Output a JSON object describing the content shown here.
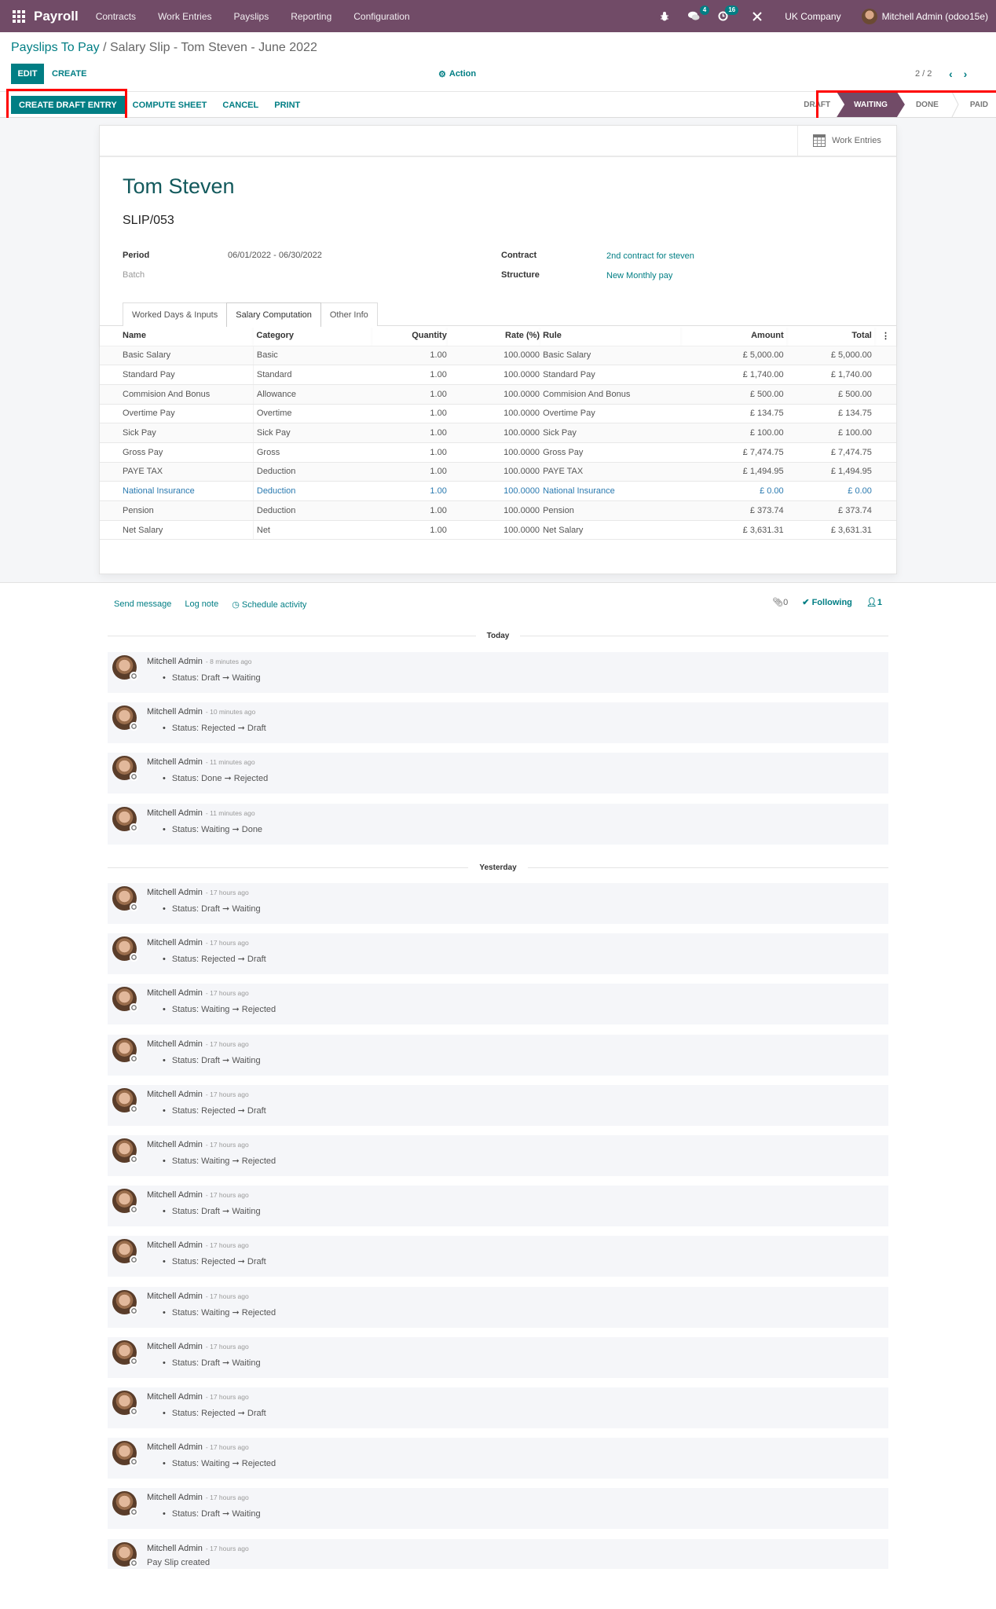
{
  "navbar": {
    "app_name": "Payroll",
    "menus": [
      "Contracts",
      "Work Entries",
      "Payslips",
      "Reporting",
      "Configuration"
    ],
    "messages_badge": "4",
    "activities_badge": "16",
    "company": "UK Company",
    "user": "Mitchell Admin (odoo15e)"
  },
  "breadcrumb": {
    "parent": "Payslips To Pay",
    "separator": " / ",
    "current": "Salary Slip - Tom Steven - June 2022"
  },
  "control": {
    "edit_label": "EDIT",
    "create_label": "CREATE",
    "action_label": "Action",
    "pager": "2 / 2"
  },
  "statusbar": {
    "buttons": {
      "create_draft_entry": "CREATE DRAFT ENTRY",
      "compute_sheet": "COMPUTE SHEET",
      "cancel": "CANCEL",
      "print": "PRINT"
    },
    "stages": [
      "DRAFT",
      "WAITING",
      "DONE",
      "PAID"
    ],
    "active_stage": "WAITING"
  },
  "sheet": {
    "smart_button": "Work Entries",
    "employee": "Tom Steven",
    "reference": "SLIP/053",
    "fields": {
      "period_label": "Period",
      "period_value": "06/01/2022 - 06/30/2022",
      "batch_label": "Batch",
      "contract_label": "Contract",
      "contract_value": "2nd contract for steven",
      "structure_label": "Structure",
      "structure_value": "New Monthly pay"
    },
    "tabs": [
      "Worked Days & Inputs",
      "Salary Computation",
      "Other Info"
    ],
    "active_tab": "Salary Computation",
    "table": {
      "headers": [
        "Name",
        "Category",
        "Quantity",
        "Rate (%)",
        "Rule",
        "Amount",
        "Total"
      ],
      "rows": [
        {
          "name": "Basic Salary",
          "category": "Basic",
          "quantity": "1.00",
          "rate": "100.0000",
          "rule": "Basic Salary",
          "amount": "£ 5,000.00",
          "total": "£ 5,000.00"
        },
        {
          "name": "Standard Pay",
          "category": "Standard",
          "quantity": "1.00",
          "rate": "100.0000",
          "rule": "Standard Pay",
          "amount": "£ 1,740.00",
          "total": "£ 1,740.00"
        },
        {
          "name": "Commision And Bonus",
          "category": "Allowance",
          "quantity": "1.00",
          "rate": "100.0000",
          "rule": "Commision And Bonus",
          "amount": "£ 500.00",
          "total": "£ 500.00"
        },
        {
          "name": "Overtime Pay",
          "category": "Overtime",
          "quantity": "1.00",
          "rate": "100.0000",
          "rule": "Overtime Pay",
          "amount": "£ 134.75",
          "total": "£ 134.75"
        },
        {
          "name": "Sick Pay",
          "category": "Sick Pay",
          "quantity": "1.00",
          "rate": "100.0000",
          "rule": "Sick Pay",
          "amount": "£ 100.00",
          "total": "£ 100.00"
        },
        {
          "name": "Gross Pay",
          "category": "Gross",
          "quantity": "1.00",
          "rate": "100.0000",
          "rule": "Gross Pay",
          "amount": "£ 7,474.75",
          "total": "£ 7,474.75"
        },
        {
          "name": "PAYE TAX",
          "category": "Deduction",
          "quantity": "1.00",
          "rate": "100.0000",
          "rule": "PAYE TAX",
          "amount": "£ 1,494.95",
          "total": "£ 1,494.95"
        },
        {
          "name": "National Insurance",
          "category": "Deduction",
          "quantity": "1.00",
          "rate": "100.0000",
          "rule": "National Insurance",
          "amount": "£ 0.00",
          "total": "£ 0.00",
          "highlight": true
        },
        {
          "name": "Pension",
          "category": "Deduction",
          "quantity": "1.00",
          "rate": "100.0000",
          "rule": "Pension",
          "amount": "£ 373.74",
          "total": "£ 373.74"
        },
        {
          "name": "Net Salary",
          "category": "Net",
          "quantity": "1.00",
          "rate": "100.0000",
          "rule": "Net Salary",
          "amount": "£ 3,631.31",
          "total": "£ 3,631.31"
        }
      ]
    }
  },
  "chatter": {
    "send_message": "Send message",
    "log_note": "Log note",
    "schedule_activity": "Schedule activity",
    "attachments_count": "0",
    "following": "Following",
    "followers_count": "1",
    "groups": [
      {
        "label": "Today",
        "messages": [
          {
            "author": "Mitchell Admin",
            "date": "- 8 minutes ago",
            "body": "Status: Draft ➞ Waiting"
          },
          {
            "author": "Mitchell Admin",
            "date": "- 10 minutes ago",
            "body": "Status: Rejected ➞ Draft"
          },
          {
            "author": "Mitchell Admin",
            "date": "- 11 minutes ago",
            "body": "Status: Done ➞ Rejected"
          },
          {
            "author": "Mitchell Admin",
            "date": "- 11 minutes ago",
            "body": "Status: Waiting ➞ Done"
          }
        ]
      },
      {
        "label": "Yesterday",
        "messages": [
          {
            "author": "Mitchell Admin",
            "date": "- 17 hours ago",
            "body": "Status: Draft ➞ Waiting"
          },
          {
            "author": "Mitchell Admin",
            "date": "- 17 hours ago",
            "body": "Status: Rejected ➞ Draft"
          },
          {
            "author": "Mitchell Admin",
            "date": "- 17 hours ago",
            "body": "Status: Waiting ➞ Rejected"
          },
          {
            "author": "Mitchell Admin",
            "date": "- 17 hours ago",
            "body": "Status: Draft ➞ Waiting"
          },
          {
            "author": "Mitchell Admin",
            "date": "- 17 hours ago",
            "body": "Status: Rejected ➞ Draft"
          },
          {
            "author": "Mitchell Admin",
            "date": "- 17 hours ago",
            "body": "Status: Waiting ➞ Rejected"
          },
          {
            "author": "Mitchell Admin",
            "date": "- 17 hours ago",
            "body": "Status: Draft ➞ Waiting"
          },
          {
            "author": "Mitchell Admin",
            "date": "- 17 hours ago",
            "body": "Status: Rejected ➞ Draft"
          },
          {
            "author": "Mitchell Admin",
            "date": "- 17 hours ago",
            "body": "Status: Waiting ➞ Rejected"
          },
          {
            "author": "Mitchell Admin",
            "date": "- 17 hours ago",
            "body": "Status: Draft ➞ Waiting"
          },
          {
            "author": "Mitchell Admin",
            "date": "- 17 hours ago",
            "body": "Status: Rejected ➞ Draft"
          },
          {
            "author": "Mitchell Admin",
            "date": "- 17 hours ago",
            "body": "Status: Waiting ➞ Rejected"
          },
          {
            "author": "Mitchell Admin",
            "date": "- 17 hours ago",
            "body": "Status: Draft ➞ Waiting"
          },
          {
            "author": "Mitchell Admin",
            "date": "- 17 hours ago",
            "body": "Pay Slip created",
            "plain": true
          }
        ]
      }
    ]
  },
  "colors": {
    "brand": "#714b67",
    "primary": "#017e84",
    "highlight_box": "#ff0000",
    "link_row": "#2a7ab0"
  }
}
